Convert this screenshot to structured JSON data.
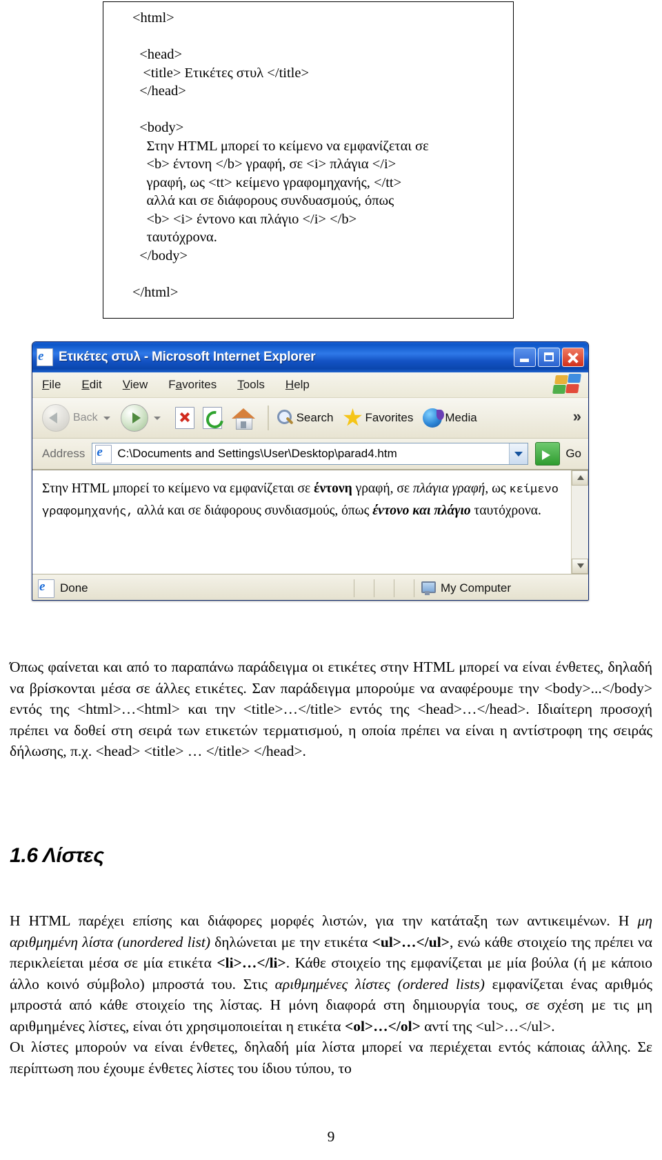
{
  "code_listing": {
    "lines": [
      "<html>",
      "",
      "  <head>",
      "   <title> Ετικέτες στυλ </title>",
      "  </head>",
      "",
      "  <body>",
      "    Στην HTML μπορεί το κείμενο να εμφανίζεται σε",
      "    <b> έντονη </b> γραφή, σε <i> πλάγια </i>",
      "    γραφή, ως <tt> κείμενο γραφομηχανής, </tt>",
      "    αλλά και σε διάφορους συνδυασμούς, όπως",
      "    <b> <i> έντονο και πλάγιο </i> </b>",
      "    ταυτόχρονα.",
      "  </body>",
      "",
      "</html>"
    ]
  },
  "browser": {
    "title": "Ετικέτες στυλ - Microsoft Internet Explorer",
    "window_buttons": {
      "minimize": "Minimize",
      "maximize": "Maximize",
      "close": "Close"
    },
    "menu": [
      {
        "label": "File",
        "accel": "F",
        "rest": "ile"
      },
      {
        "label": "Edit",
        "accel": "E",
        "rest": "dit"
      },
      {
        "label": "View",
        "accel": "V",
        "rest": "iew"
      },
      {
        "label": "Favorites",
        "pre": "F",
        "accel": "a",
        "rest": "vorites"
      },
      {
        "label": "Tools",
        "accel": "T",
        "rest": "ools"
      },
      {
        "label": "Help",
        "accel": "H",
        "rest": "elp"
      }
    ],
    "toolbar": {
      "back": "Back",
      "forward": "Forward",
      "stop": "Stop",
      "refresh": "Refresh",
      "home": "Home",
      "search": "Search",
      "favorites": "Favorites",
      "media": "Media",
      "overflow": "»"
    },
    "address": {
      "label": "Address",
      "value": "C:\\Documents and Settings\\User\\Desktop\\parad4.htm",
      "go": "Go"
    },
    "page_content": {
      "t1": "Στην HTML μπορεί το κείμενο να εμφανίζεται σε ",
      "bold1": "έντονη",
      "t2": " γραφή, σε ",
      "italic1": "πλάγια γραφή",
      "t3": ", ως ",
      "mono1": "κείμενο γραφομηχανής,",
      "t4": "  αλλά και σε διάφορους συνδιασμούς, όπως ",
      "bolditalic1": "έντονο και πλάγιο",
      "t5": " ταυτόχρονα."
    },
    "status": {
      "text": "Done",
      "zone": "My Computer"
    }
  },
  "paragraph_1": {
    "t1": "Όπως φαίνεται και από το παραπάνω παράδειγμα οι ετικέτες στην HTML μπορεί να είναι ένθετες, δηλαδή να βρίσκονται μέσα σε άλλες ετικέτες. Σαν παράδειγμα μπορούμε να αναφέρουμε την <body>...</body> εντός της <html>…<html> και την <title>…</title> εντός της <head>…</head>. Ιδιαίτερη προσοχή πρέπει να δοθεί στη σειρά των ετικετών τερματισμού, η οποία πρέπει να είναι η αντίστροφη της σειράς δήλωσης, π.χ. <head> <title> … </title> </head>."
  },
  "heading": {
    "number": "1.6",
    "title": "Λίστες",
    "full": "1.6 Λίστες"
  },
  "paragraph_2": {
    "s1": "Η HTML παρέχει επίσης και διάφορες μορφές λιστών, για την κατάταξη των αντικειμένων. Η ",
    "i1": "μη αριθμημένη λίστα (unordered list)",
    "s2": " δηλώνεται με την ετικέτα ",
    "b1": "<ul>…</ul>",
    "s3": ", ενώ κάθε στοιχείο της πρέπει να περικλείεται μέσα σε μία ετικέτα ",
    "b2": "<li>…</li>",
    "s4": ". Κάθε στοιχείο της εμφανίζεται με μία βούλα (ή με κάποιο άλλο κοινό σύμβολο) μπροστά του. Στις ",
    "i2": "αριθμημένες λίστες (ordered lists)",
    "s5": " εμφανίζεται ένας αριθμός μπροστά από κάθε στοιχείο της λίστας. Η μόνη διαφορά στη δημιουργία τους, σε σχέση με τις μη αριθμημένες λίστες, είναι ότι χρησιμοποιείται η ετικέτα ",
    "b3": "<ol>…</ol>",
    "s6": " αντί της <ul>…</ul>.",
    "s7": "Οι λίστες μπορούν να είναι ένθετες, δηλαδή μία λίστα μπορεί να περιέχεται εντός κάποιας άλλης. Σε περίπτωση που έχουμε ένθετες λίστες του ίδιου τύπου, το"
  },
  "page_number": "9"
}
